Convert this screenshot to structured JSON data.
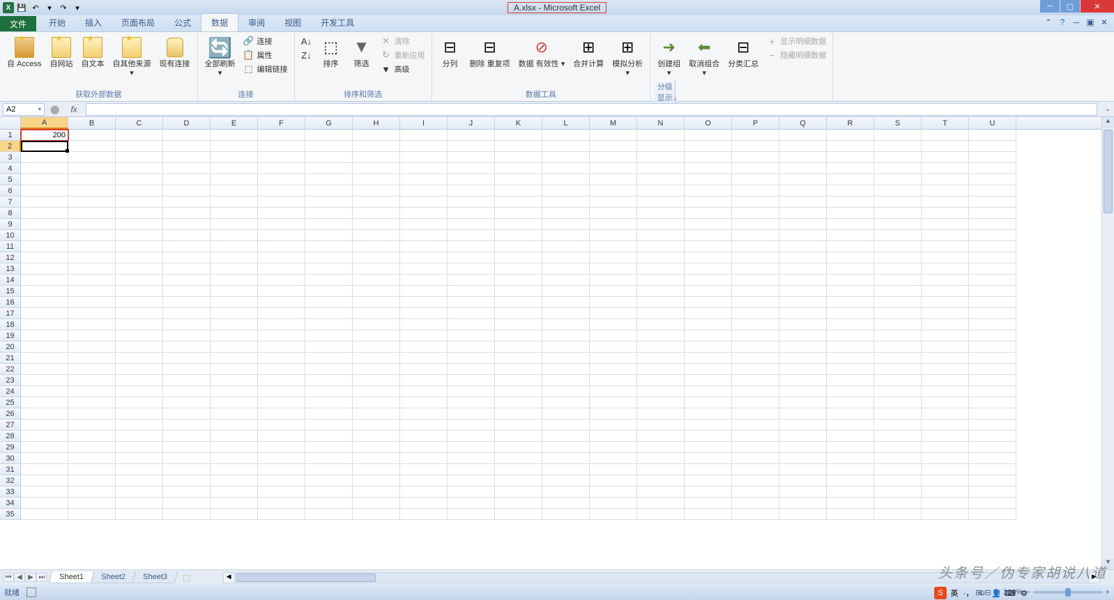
{
  "title": "A.xlsx - Microsoft Excel",
  "qat": {
    "save": "💾",
    "undo": "↶",
    "redo": "↷"
  },
  "tabs": {
    "file": "文件",
    "items": [
      "开始",
      "插入",
      "页面布局",
      "公式",
      "数据",
      "审阅",
      "视图",
      "开发工具"
    ],
    "active_index": 4
  },
  "ribbon": {
    "group_external": {
      "label": "获取外部数据",
      "access": "自 Access",
      "web": "自网站",
      "text": "自文本",
      "other": "自其他来源",
      "existing": "现有连接"
    },
    "group_conn": {
      "label": "连接",
      "refresh": "全部刷新",
      "connections": "连接",
      "properties": "属性",
      "editlinks": "编辑链接"
    },
    "group_sort": {
      "label": "排序和筛选",
      "sort": "排序",
      "filter": "筛选",
      "clear": "清除",
      "reapply": "重新应用",
      "advanced": "高级"
    },
    "group_tools": {
      "label": "数据工具",
      "t2c": "分列",
      "dedup": "删除\n重复项",
      "validation": "数据\n有效性",
      "consolidate": "合并计算",
      "whatif": "模拟分析"
    },
    "group_outline": {
      "label": "分级显示",
      "group": "创建组",
      "ungroup": "取消组合",
      "subtotal": "分类汇总",
      "show": "显示明细数据",
      "hide": "隐藏明细数据"
    }
  },
  "namebox": "A2",
  "columns": [
    "A",
    "B",
    "C",
    "D",
    "E",
    "F",
    "G",
    "H",
    "I",
    "J",
    "K",
    "L",
    "M",
    "N",
    "O",
    "P",
    "Q",
    "R",
    "S",
    "T",
    "U"
  ],
  "rows": 35,
  "cell_a1": "200",
  "sheets": {
    "list": [
      "Sheet1",
      "Sheet2",
      "Sheet3"
    ],
    "active": 0
  },
  "status": {
    "ready": "就绪",
    "zoom": "100%"
  },
  "watermark": "头条号／伪专家胡说八道",
  "ime": "英"
}
